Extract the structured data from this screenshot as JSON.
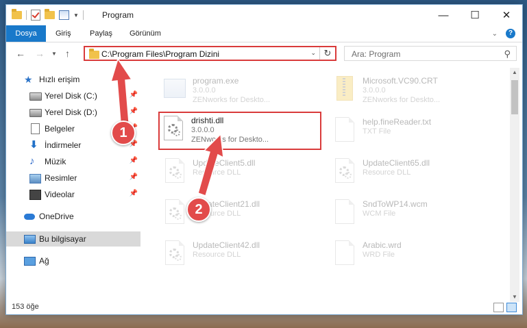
{
  "window": {
    "title": "Program"
  },
  "ribbon": {
    "tabs": [
      "Dosya",
      "Giriş",
      "Paylaş",
      "Görünüm"
    ]
  },
  "address": {
    "path": "C:\\Program Files\\Program Dizini"
  },
  "search": {
    "placeholder": "Ara: Program"
  },
  "sidebar": {
    "items": [
      {
        "label": "Hızlı erişim",
        "icon": "star-icon"
      },
      {
        "label": "Yerel Disk (C:)",
        "icon": "disk-icon",
        "pinned": true
      },
      {
        "label": "Yerel Disk (D:)",
        "icon": "disk-icon",
        "pinned": true
      },
      {
        "label": "Belgeler",
        "icon": "document-icon",
        "pinned": true
      },
      {
        "label": "İndirmeler",
        "icon": "download-icon",
        "pinned": true
      },
      {
        "label": "Müzik",
        "icon": "music-icon",
        "pinned": true
      },
      {
        "label": "Resimler",
        "icon": "pictures-icon",
        "pinned": true
      },
      {
        "label": "Videolar",
        "icon": "video-icon",
        "pinned": true
      },
      {
        "label": "OneDrive",
        "icon": "cloud-icon"
      },
      {
        "label": "Bu bilgisayar",
        "icon": "computer-icon",
        "selected": true
      },
      {
        "label": "Ağ",
        "icon": "network-icon"
      }
    ]
  },
  "files": [
    {
      "name": "program.exe",
      "line1": "3.0.0.0",
      "line2": "ZENworks for Deskto...",
      "icon": "exe-icon",
      "faded": true
    },
    {
      "name": "Microsoft.VC90.CRT",
      "line1": "3.0.0.0",
      "line2": "ZENworks for Deskto...",
      "icon": "zip-folder-icon",
      "faded": true
    },
    {
      "name": "drishti.dll",
      "line1": "3.0.0.0",
      "line2": "ZENworks for Deskto...",
      "icon": "dll-gear-icon",
      "faded": false,
      "highlighted": true
    },
    {
      "name": "help.fineReader.txt",
      "line1": "TXT File",
      "line2": "",
      "icon": "txt-file-icon",
      "faded": true
    },
    {
      "name": "UpdateClient5.dll",
      "line1": "Resource DLL",
      "line2": "",
      "icon": "dll-gear-icon",
      "faded": true
    },
    {
      "name": "UpdateClient65.dll",
      "line1": "Resource DLL",
      "line2": "",
      "icon": "dll-gear-icon",
      "faded": true
    },
    {
      "name": "UpdateClient21.dll",
      "line1": "Resource DLL",
      "line2": "",
      "icon": "dll-gear-icon",
      "faded": true
    },
    {
      "name": "SndToWP14.wcm",
      "line1": "WCM File",
      "line2": "",
      "icon": "blank-file-icon",
      "faded": true
    },
    {
      "name": "UpdateClient42.dll",
      "line1": "Resource DLL",
      "line2": "",
      "icon": "dll-gear-icon",
      "faded": true
    },
    {
      "name": "Arabic.wrd",
      "line1": "WRD File",
      "line2": "",
      "icon": "blank-file-icon",
      "faded": true
    }
  ],
  "status": {
    "count": "153 öğe"
  },
  "annotations": {
    "step1": "1",
    "step2": "2",
    "color": "#e24b4b"
  }
}
